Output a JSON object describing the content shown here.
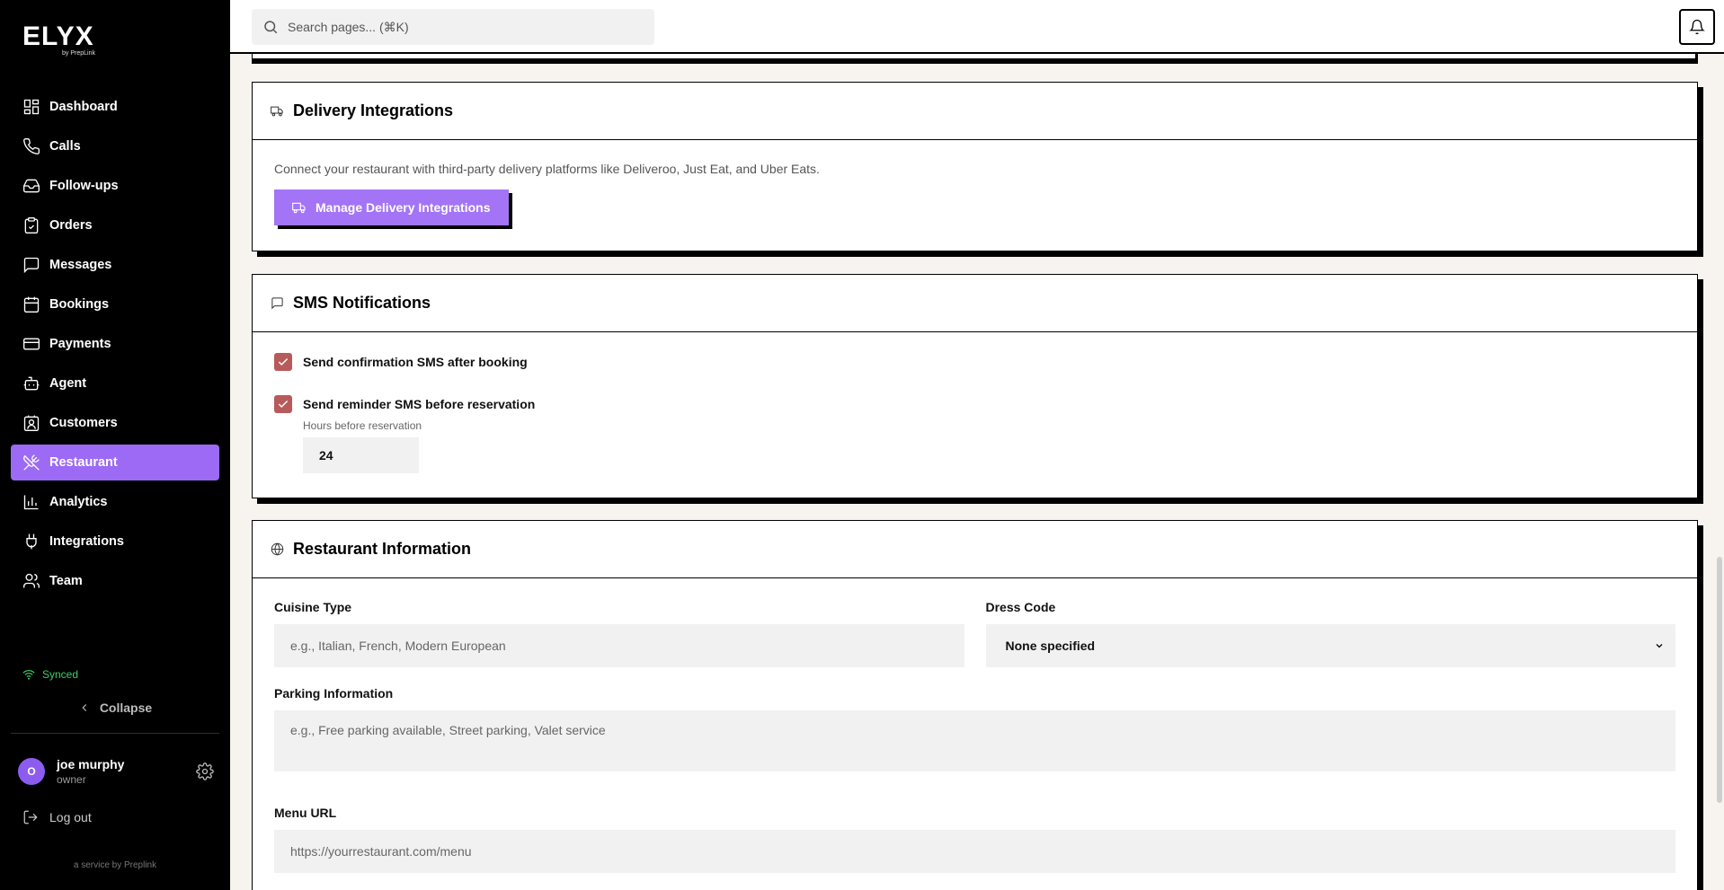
{
  "brand": {
    "logo": "ELYX",
    "sub": "by PrepLink"
  },
  "sidebar": {
    "items": [
      {
        "label": "Dashboard",
        "icon": "dashboard-icon"
      },
      {
        "label": "Calls",
        "icon": "phone-icon"
      },
      {
        "label": "Follow-ups",
        "icon": "inbox-icon"
      },
      {
        "label": "Orders",
        "icon": "clipboard-icon"
      },
      {
        "label": "Messages",
        "icon": "message-icon"
      },
      {
        "label": "Bookings",
        "icon": "calendar-icon"
      },
      {
        "label": "Payments",
        "icon": "credit-card-icon"
      },
      {
        "label": "Agent",
        "icon": "bot-icon"
      },
      {
        "label": "Customers",
        "icon": "contact-icon"
      },
      {
        "label": "Restaurant",
        "icon": "utensils-icon",
        "active": true
      },
      {
        "label": "Analytics",
        "icon": "bar-chart-icon"
      },
      {
        "label": "Integrations",
        "icon": "plug-icon"
      },
      {
        "label": "Team",
        "icon": "users-icon"
      }
    ],
    "synced": "Synced",
    "collapse": "Collapse",
    "user": {
      "initial": "O",
      "name": "joe murphy",
      "role": "owner"
    },
    "logout": "Log out",
    "service": "a service by Preplink"
  },
  "topbar": {
    "search_placeholder": "Search pages... (⌘K)"
  },
  "delivery": {
    "title": "Delivery Integrations",
    "description": "Connect your restaurant with third-party delivery platforms like Deliveroo, Just Eat, and Uber Eats.",
    "button": "Manage Delivery Integrations"
  },
  "sms": {
    "title": "SMS Notifications",
    "confirm_label": "Send confirmation SMS after booking",
    "confirm_checked": true,
    "reminder_label": "Send reminder SMS before reservation",
    "reminder_checked": true,
    "hours_label": "Hours before reservation",
    "hours_value": "24"
  },
  "info": {
    "title": "Restaurant Information",
    "cuisine_label": "Cuisine Type",
    "cuisine_placeholder": "e.g., Italian, French, Modern European",
    "dress_label": "Dress Code",
    "dress_value": "None specified",
    "parking_label": "Parking Information",
    "parking_placeholder": "e.g., Free parking available, Street parking, Valet service",
    "menu_label": "Menu URL",
    "menu_placeholder": "https://yourrestaurant.com/menu"
  },
  "colors": {
    "accent": "#a474f7",
    "checkbox": "#b85a5a",
    "synced": "#3ccf6a"
  }
}
